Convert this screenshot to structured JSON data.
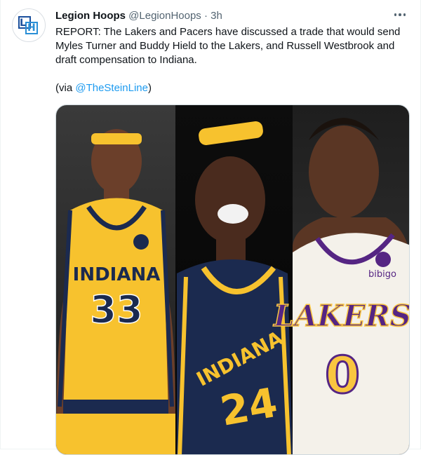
{
  "tweet": {
    "author_name": "Legion Hoops",
    "author_handle": "@LegionHoops",
    "separator": "·",
    "timestamp": "3h",
    "text": "REPORT: The Lakers and Pacers have discussed a trade that would send Myles Turner and Buddy Hield to the Lakers, and Russell Westbrook and draft compensation to Indiana.",
    "via_prefix": "(via ",
    "via_mention": "@TheSteinLine",
    "via_suffix": ")"
  },
  "media": {
    "jersey_left_team": "INDIANA",
    "jersey_left_number": "33",
    "jersey_middle_team": "INDIANA",
    "jersey_middle_number": "24",
    "jersey_right_team": "LAKERS",
    "jersey_right_number": "0",
    "jersey_right_sponsor": "bibigo"
  },
  "icons": {
    "more": "more-horizontal-icon",
    "avatar_logo": "legion-hoops-logo"
  },
  "colors": {
    "accent": "#1d9bf0",
    "pacers_navy": "#1b2a4f",
    "pacers_gold": "#f7c22e",
    "lakers_purple": "#552583",
    "lakers_gold": "#f9c640"
  }
}
